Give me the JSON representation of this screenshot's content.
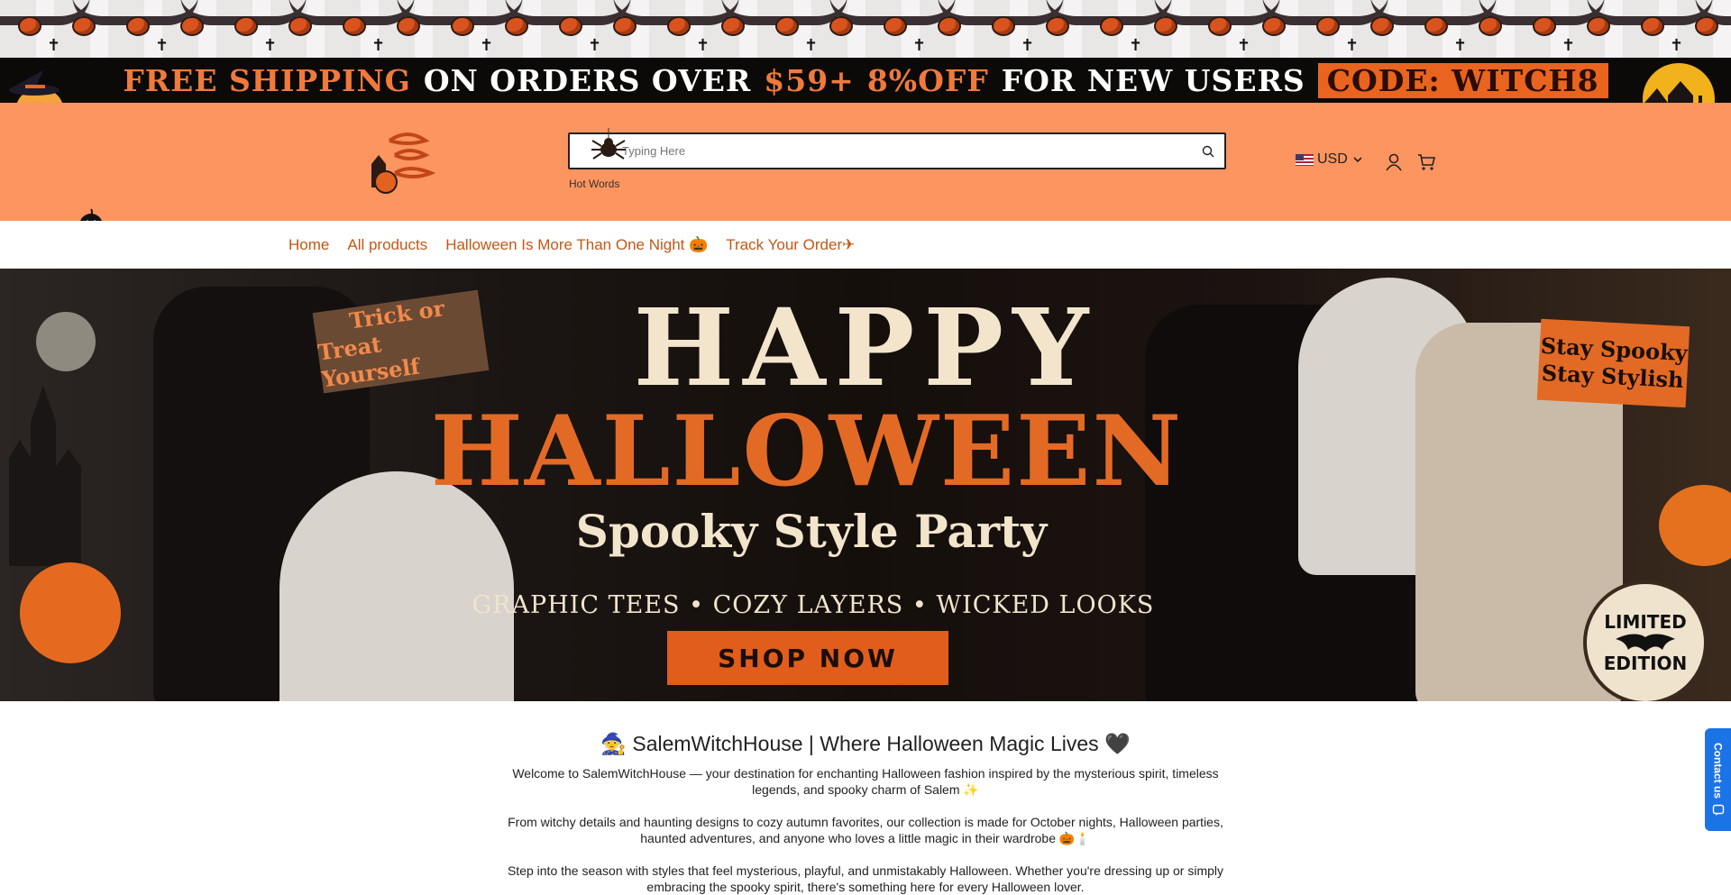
{
  "promo": {
    "free_shipping": "FREE SHIPPING",
    "on_orders_over": "ON ORDERS OVER",
    "threshold": "$59+",
    "discount": "8%OFF",
    "for_new_users": "FOR NEW USERS",
    "code": "CODE: WITCH8"
  },
  "header": {
    "search_placeholder": "Typing Here",
    "hot_words": "Hot Words",
    "currency": "USD"
  },
  "nav": {
    "items": [
      "Home",
      "All products",
      "Halloween Is More Than One Night 🎃",
      "Track Your Order✈"
    ]
  },
  "hero": {
    "sign_left": [
      "Trick or",
      "Treat Yourself"
    ],
    "sign_right": [
      "Stay Spooky",
      "Stay Stylish"
    ],
    "headline_top": "HAPPY",
    "headline_main": "HALLOWEEN",
    "subhead": "Spooky Style Party",
    "tagline": "GRAPHIC TEES • COZY LAYERS • WICKED LOOKS",
    "cta": "SHOP NOW",
    "badge": [
      "LIMITED",
      "EDITION"
    ]
  },
  "intro": {
    "title": "🧙 SalemWitchHouse | Where Halloween Magic Lives 🖤",
    "p1": "Welcome to SalemWitchHouse — your destination for enchanting Halloween fashion inspired by the mysterious spirit, timeless legends, and spooky charm of Salem ✨",
    "p2": "From witchy details and haunting designs to cozy autumn favorites, our collection is made for October nights, Halloween parties, haunted adventures, and anyone who loves a little magic in their wardrobe 🎃🕯️",
    "p3": "Step into the season with styles that feel mysterious, playful, and unmistakably Halloween. Whether you're dressing up or simply embracing the spooky spirit, there's something here for every Halloween lover."
  },
  "contact": {
    "label": "Contact us"
  },
  "colors": {
    "header_bg": "#fc955f",
    "promo_bg": "#0c0a09",
    "accent_orange": "#e36a25",
    "nav_link": "#c35716",
    "contact_blue": "#1b73e8"
  }
}
